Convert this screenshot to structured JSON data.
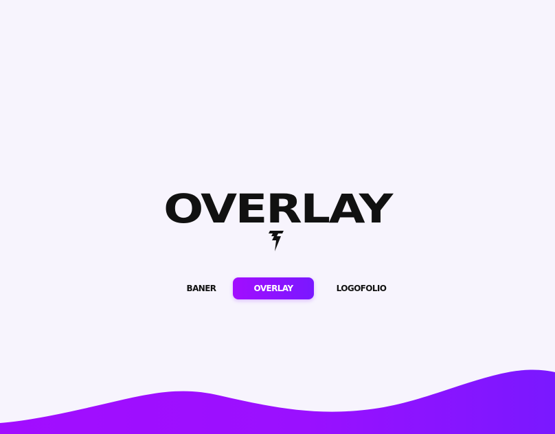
{
  "hero": {
    "title": "OVERLAY",
    "logo_icon": "lightning-bolt-logo-icon"
  },
  "nav": {
    "items": [
      {
        "label": "BANER",
        "active": false
      },
      {
        "label": "OVERLAY",
        "active": true
      },
      {
        "label": "LOGOFOLIO",
        "active": false
      }
    ]
  },
  "colors": {
    "background": "#f7f4fd",
    "text": "#111111",
    "accent_start": "#a20dff",
    "accent_end": "#7a18ff"
  }
}
